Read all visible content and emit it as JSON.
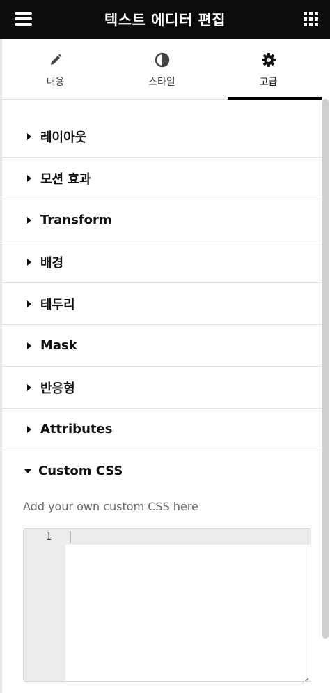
{
  "header": {
    "title": "텍스트 에디터 편집",
    "menu_icon": "hamburger-menu-icon",
    "widgets_icon": "apps-grid-icon",
    "background": "#0b0b0b"
  },
  "tabs": [
    {
      "label": "내용",
      "icon": "pencil-icon",
      "active": false
    },
    {
      "label": "스타일",
      "icon": "half-circle-contrast-icon",
      "active": false
    },
    {
      "label": "고급",
      "icon": "gear-icon",
      "active": true
    }
  ],
  "sections": [
    {
      "label": "레이아웃",
      "expanded": false
    },
    {
      "label": "모션 효과",
      "expanded": false
    },
    {
      "label": "Transform",
      "expanded": false
    },
    {
      "label": "배경",
      "expanded": false
    },
    {
      "label": "테두리",
      "expanded": false
    },
    {
      "label": "Mask",
      "expanded": false
    },
    {
      "label": "반응형",
      "expanded": false
    },
    {
      "label": "Attributes",
      "expanded": false
    },
    {
      "label": "Custom CSS",
      "expanded": true
    }
  ],
  "custom_css": {
    "description": "Add your own custom CSS here",
    "line_number": "1",
    "code": ""
  }
}
